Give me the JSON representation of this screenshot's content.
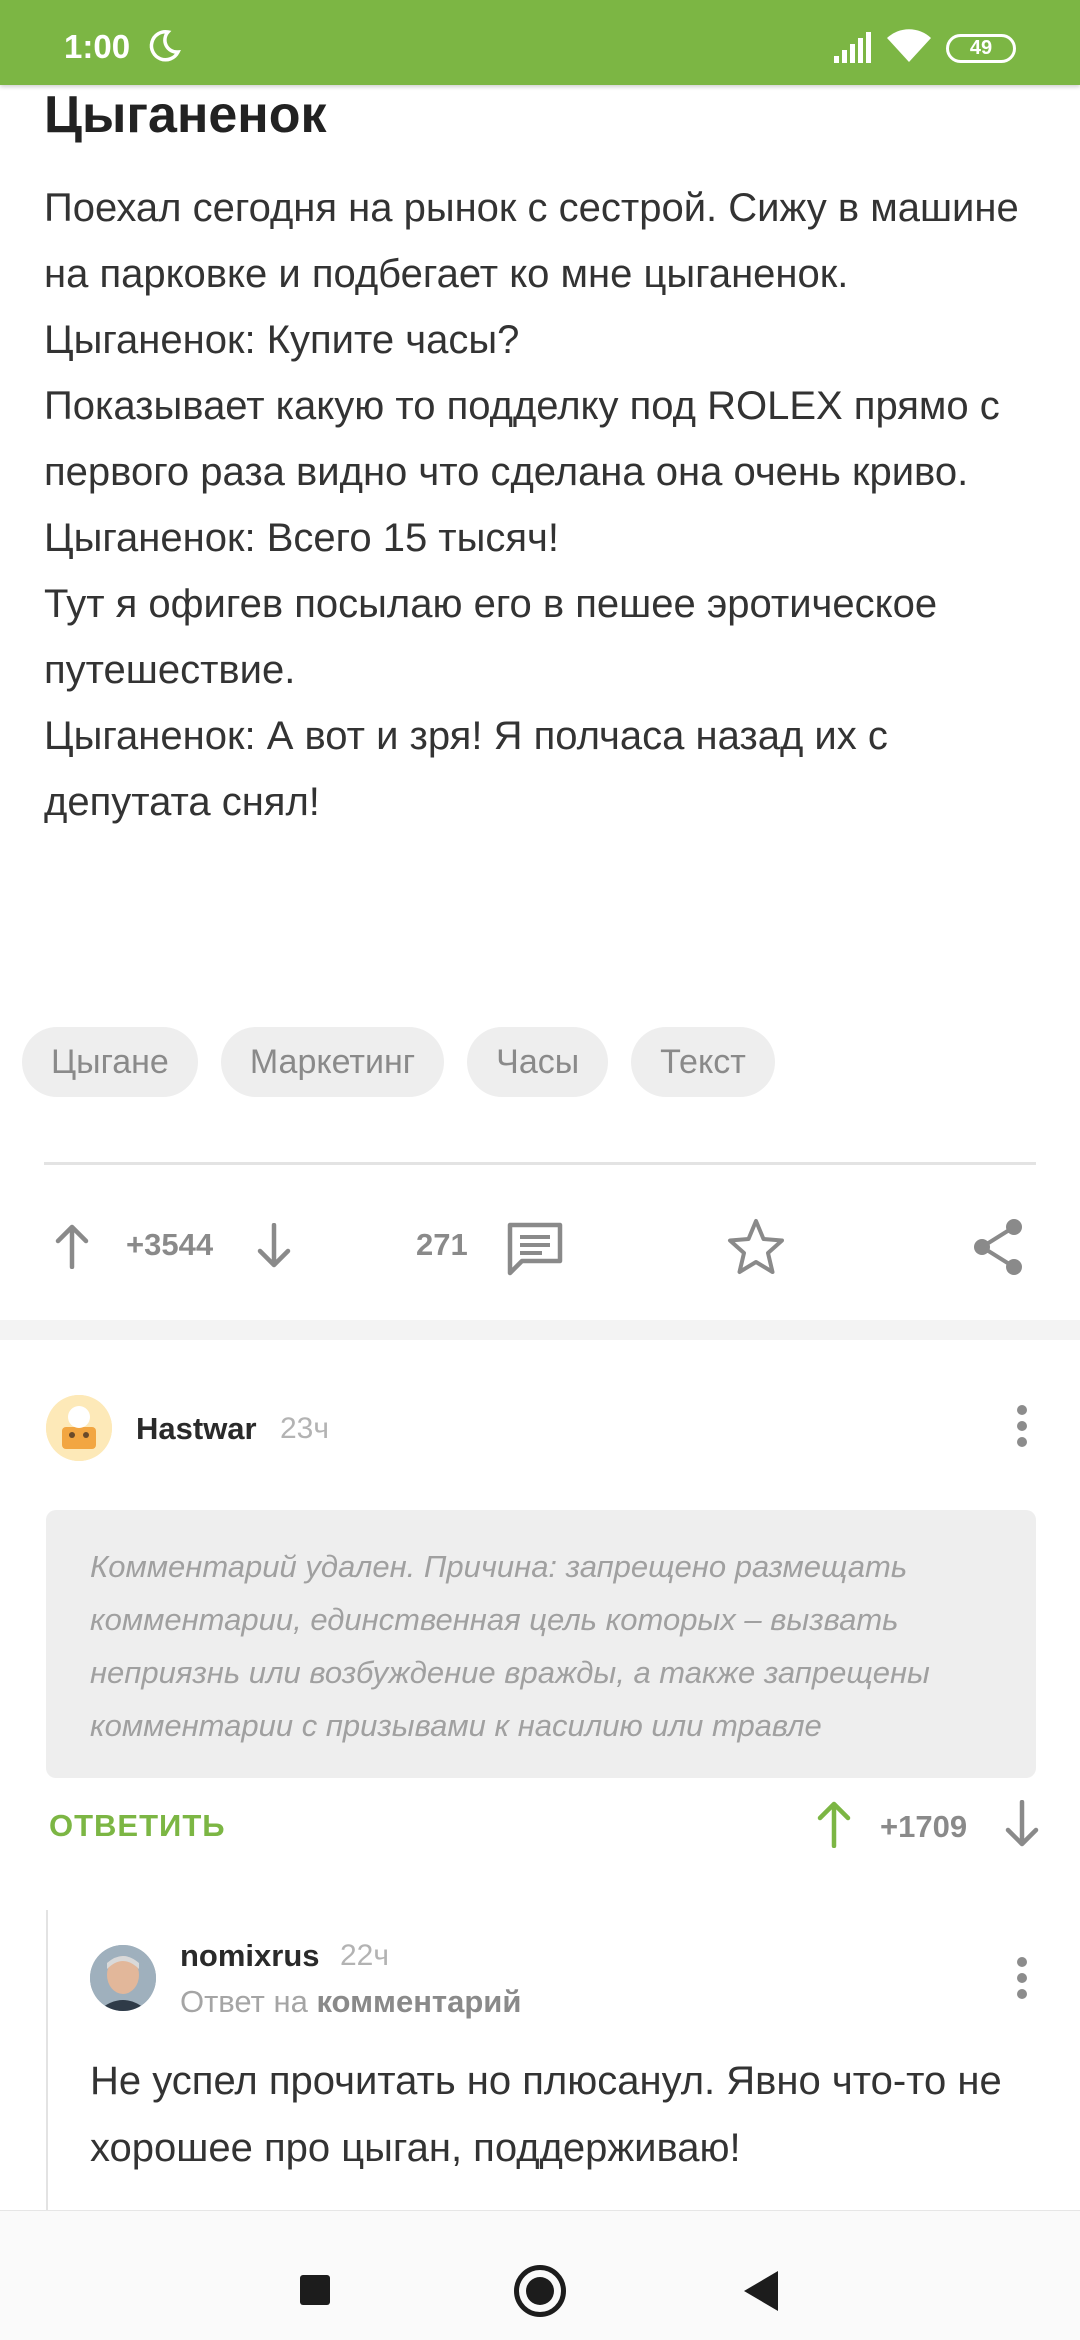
{
  "status_bar": {
    "time": "1:00",
    "battery": "49"
  },
  "post": {
    "title": "Цыганенок",
    "paragraphs": [
      "Поехал сегодня на рынок с сестрой. Сижу в машине на парковке и подбегает ко мне цыганенок.",
      "Цыганенок: Купите часы?",
      "Показывает какую то подделку под ROLEX прямо с первого раза видно что сделана она очень криво.",
      "Цыганенок: Всего 15 тысяч!",
      "Тут я офигев посылаю его в пешее эротическое путешествие.",
      "Цыганенок: А вот и зря! Я полчаса назад их с депутата снял!"
    ],
    "tags": [
      "Цыгане",
      "Маркетинг",
      "Часы",
      "Текст"
    ],
    "rating": "+3544",
    "comments_count": "271"
  },
  "comment1": {
    "author": "Hastwar",
    "time": "23ч",
    "deleted_text": "Комментарий удален. Причина: запрещено размещать комментарии, единственная цель которых – вызвать неприязнь или возбуждение вражды, а также запрещены комментарии с призывами к насилию или травле",
    "reply_label": "ОТВЕТИТЬ",
    "rating": "+1709"
  },
  "comment2": {
    "author": "nomixrus",
    "time": "22ч",
    "reply_prefix": "Ответ на",
    "reply_target": "комментарий",
    "text": "Не успел прочитать но плюсанул. Явно что-то не хорошее про цыган, поддерживаю!"
  },
  "colors": {
    "brand_green": "#7cb644",
    "muted": "#8a8a8a"
  },
  "icons": [
    "moon-icon",
    "signal-icon",
    "wifi-icon",
    "upvote-icon",
    "downvote-icon",
    "comments-icon",
    "star-icon",
    "share-icon",
    "more-icon",
    "nav-recents-icon",
    "nav-home-icon",
    "nav-back-icon"
  ]
}
